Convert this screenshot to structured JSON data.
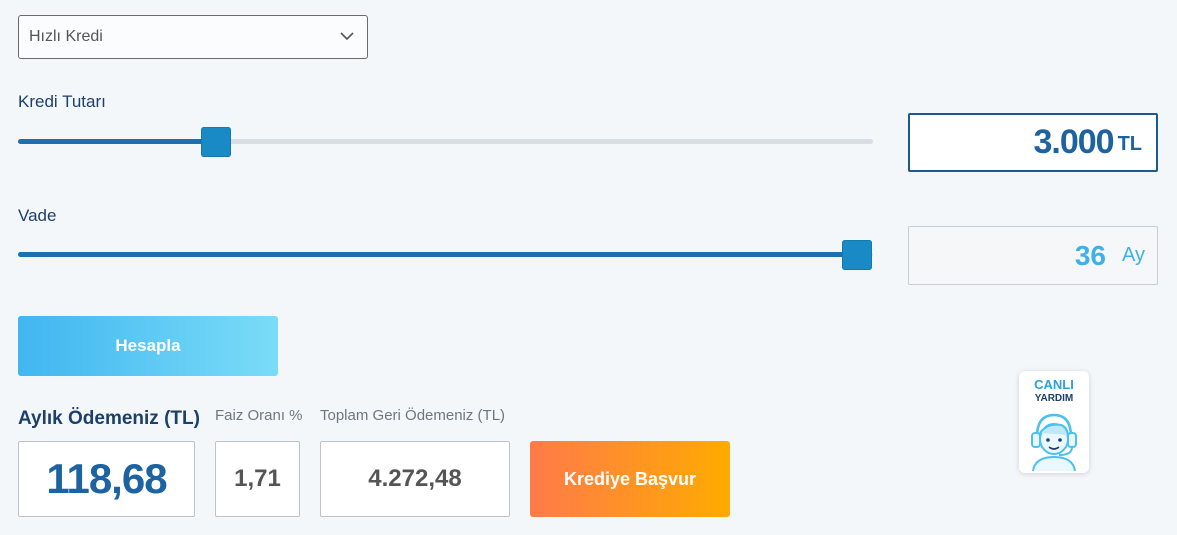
{
  "loan_type": {
    "selected": "Hızlı Kredi"
  },
  "amount": {
    "label": "Kredi Tutarı",
    "value": "3.000",
    "unit": "TL",
    "slider_fraction": 0.231
  },
  "term": {
    "label": "Vade",
    "value": "36",
    "unit": "Ay",
    "slider_fraction": 0.981
  },
  "calculate_button": {
    "label": "Hesapla"
  },
  "results": {
    "monthly_label": "Aylık Ödemeniz (TL)",
    "monthly_value": "118,68",
    "rate_label": "Faiz Oranı %",
    "rate_value": "1,71",
    "total_label": "Toplam Geri Ödemeniz (TL)",
    "total_value": "4.272,48"
  },
  "apply_button": {
    "label": "Krediye Başvur"
  },
  "live_help": {
    "line1": "CANLI",
    "line2": "YARDIM"
  },
  "colors": {
    "primary": "#1d62a1",
    "accent": "#3fb0ea",
    "apply_start": "#ff7a4a",
    "apply_end": "#ffab00"
  }
}
